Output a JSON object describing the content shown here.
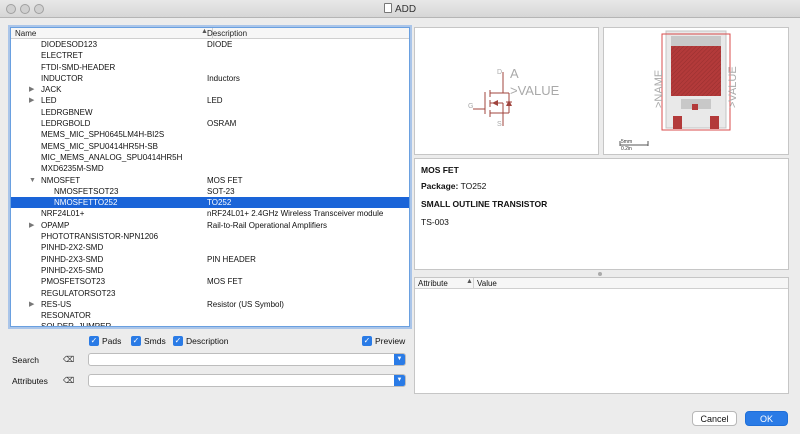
{
  "window": {
    "title": "ADD"
  },
  "tree": {
    "col_name": "Name",
    "col_desc": "Description",
    "rows": [
      {
        "name": "DIODESOD123",
        "desc": "DIODE",
        "twisty": "",
        "child": false,
        "selected": false
      },
      {
        "name": "ELECTRET",
        "desc": "",
        "twisty": "",
        "child": false,
        "selected": false
      },
      {
        "name": "FTDI-SMD-HEADER",
        "desc": "",
        "twisty": "",
        "child": false,
        "selected": false
      },
      {
        "name": "INDUCTOR",
        "desc": "Inductors",
        "twisty": "",
        "child": false,
        "selected": false
      },
      {
        "name": "JACK",
        "desc": "",
        "twisty": "▶",
        "child": false,
        "selected": false
      },
      {
        "name": "LED",
        "desc": "LED",
        "twisty": "▶",
        "child": false,
        "selected": false
      },
      {
        "name": "LEDRGBNEW",
        "desc": "",
        "twisty": "",
        "child": false,
        "selected": false
      },
      {
        "name": "LEDRGBOLD",
        "desc": "OSRAM",
        "twisty": "",
        "child": false,
        "selected": false
      },
      {
        "name": "MEMS_MIC_SPH0645LM4H-BI2S",
        "desc": "",
        "twisty": "",
        "child": false,
        "selected": false
      },
      {
        "name": "MEMS_MIC_SPU0414HR5H-SB",
        "desc": "",
        "twisty": "",
        "child": false,
        "selected": false
      },
      {
        "name": "MIC_MEMS_ANALOG_SPU0414HR5H",
        "desc": "",
        "twisty": "",
        "child": false,
        "selected": false
      },
      {
        "name": "MXD6235M-SMD",
        "desc": "",
        "twisty": "",
        "child": false,
        "selected": false
      },
      {
        "name": "NMOSFET",
        "desc": "MOS FET",
        "twisty": "▼",
        "child": false,
        "selected": false
      },
      {
        "name": "NMOSFETSOT23",
        "desc": "SOT-23",
        "twisty": "",
        "child": true,
        "selected": false
      },
      {
        "name": "NMOSFETTO252",
        "desc": "TO252",
        "twisty": "",
        "child": true,
        "selected": true
      },
      {
        "name": "NRF24L01+",
        "desc": "nRF24L01+ 2.4GHz Wireless Transceiver module",
        "twisty": "",
        "child": false,
        "selected": false
      },
      {
        "name": "OPAMP",
        "desc": "Rail-to-Rail Operational Amplifiers",
        "twisty": "▶",
        "child": false,
        "selected": false
      },
      {
        "name": "PHOTOTRANSISTOR-NPN1206",
        "desc": "",
        "twisty": "",
        "child": false,
        "selected": false
      },
      {
        "name": "PINHD-2X2-SMD",
        "desc": "",
        "twisty": "",
        "child": false,
        "selected": false
      },
      {
        "name": "PINHD-2X3-SMD",
        "desc": "PIN HEADER",
        "twisty": "",
        "child": false,
        "selected": false
      },
      {
        "name": "PINHD-2X5-SMD",
        "desc": "",
        "twisty": "",
        "child": false,
        "selected": false
      },
      {
        "name": "PMOSFETSOT23",
        "desc": "MOS FET",
        "twisty": "",
        "child": false,
        "selected": false
      },
      {
        "name": "REGULATORSOT23",
        "desc": "",
        "twisty": "",
        "child": false,
        "selected": false
      },
      {
        "name": "RES-US",
        "desc": "Resistor (US Symbol)",
        "twisty": "▶",
        "child": false,
        "selected": false
      },
      {
        "name": "RESONATOR",
        "desc": "",
        "twisty": "",
        "child": false,
        "selected": false
      },
      {
        "name": "SOLDER_JUMPER",
        "desc": "",
        "twisty": "",
        "child": false,
        "selected": false
      }
    ]
  },
  "options": {
    "pads": "Pads",
    "smds": "Smds",
    "description": "Description",
    "preview": "Preview"
  },
  "filters": {
    "search_label": "Search",
    "attributes_label": "Attributes"
  },
  "symbol_preview": {
    "label_a": "A",
    "label_value": ">VALUE",
    "pin_g": "G",
    "pin_d": "D",
    "pin_s": "S"
  },
  "package_preview": {
    "label_name": ">NAME",
    "label_value": ">VALUE",
    "scale_text": "5mm",
    "scale_sub": "0.2in"
  },
  "info": {
    "title": "MOS FET",
    "package_label": "Package:",
    "package_value": "TO252",
    "heading": "SMALL OUTLINE TRANSISTOR",
    "code": "TS-003"
  },
  "attributes": {
    "col_attribute": "Attribute",
    "col_value": "Value"
  },
  "buttons": {
    "cancel": "Cancel",
    "ok": "OK"
  },
  "colors": {
    "accent": "#2a7be6",
    "selection": "#1a64d8",
    "schematic": "#a0443e",
    "package_fill": "#b33a3a"
  }
}
